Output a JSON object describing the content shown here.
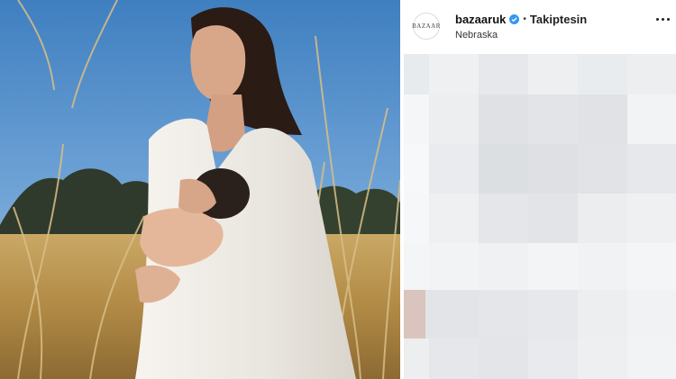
{
  "post": {
    "photo_alt": "mother-breastfeeding-photo",
    "username": "bazaaruk",
    "avatar_text": "BAZAAR",
    "follow_status": "Takiptesin",
    "location": "Nebraska",
    "verified": true
  },
  "colors": {
    "accent": "#3897f0",
    "sky": "#4a88c6",
    "grass": "#b8954f"
  },
  "icons": {
    "verified": "verified-badge-icon",
    "more": "more-options-icon"
  }
}
